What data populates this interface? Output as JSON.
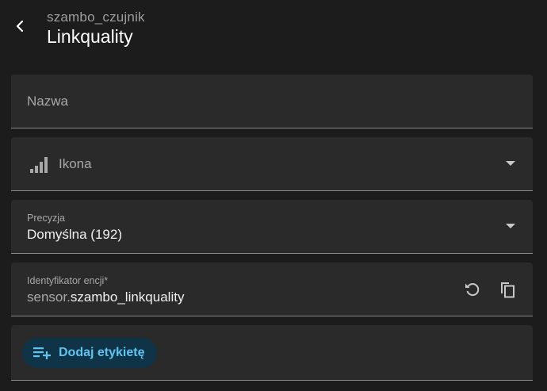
{
  "header": {
    "subtitle": "szambo_czujnik",
    "title": "Linkquality"
  },
  "form": {
    "name_placeholder": "Nazwa",
    "icon": {
      "label": "Ikona",
      "icon_name": "signal-bars-icon"
    },
    "precision": {
      "label": "Precyzja",
      "value": "Domyślna (192)"
    },
    "entity_id": {
      "label": "Identyfikator encji*",
      "prefix": "sensor.",
      "value": "szambo_linkquality"
    },
    "labels": {
      "add_label": "Dodaj etykietę"
    }
  },
  "colors": {
    "background": "#1c1c1c",
    "field_background": "#2a2a2a",
    "chip_background": "#0f3447",
    "accent": "#5fc4f2"
  }
}
